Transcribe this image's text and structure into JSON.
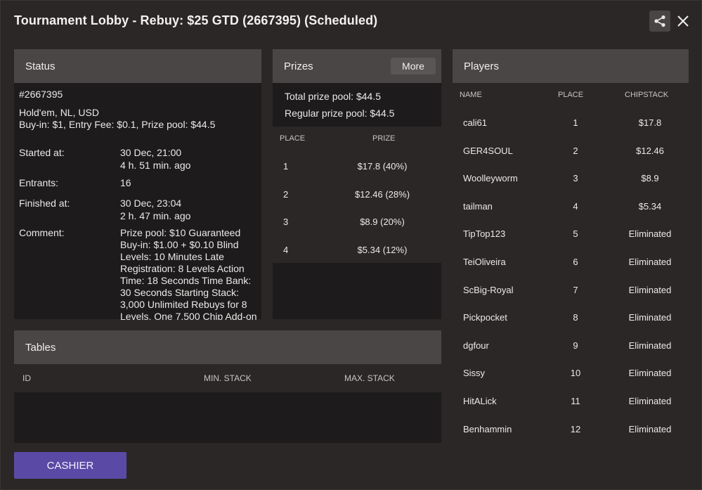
{
  "window": {
    "title": "Tournament Lobby - Rebuy: $25 GTD (2667395) (Scheduled)"
  },
  "icons": {
    "share": "share-icon",
    "close": "close-icon"
  },
  "colors": {
    "accent": "#5a4aa5",
    "panel_header": "#4b4646",
    "panel_body": "#1d1b1b"
  },
  "status": {
    "heading": "Status",
    "id": "#2667395",
    "game": "Hold'em, NL, USD",
    "buyin_line": "Buy-in: $1, Entry Fee: $0.1, Prize pool: $44.5",
    "started_label": "Started at:",
    "started_date": "30 Dec, 21:00",
    "started_ago": "4 h. 51 min. ago",
    "entrants_label": "Entrants:",
    "entrants_value": "16",
    "finished_label": "Finished at:",
    "finished_date": "30 Dec, 23:04",
    "finished_ago": "2 h. 47 min. ago",
    "comment_label": "Comment:",
    "comment_text": "Prize pool: $10 Guaranteed Buy-in: $1.00 + $0.10 Blind Levels: 10 Minutes Late Registration: 8 Levels Action Time: 18 Seconds Time Bank: 30 Seconds Starting Stack: 3,000 Unlimited Rebuys for 8 Levels. One 7,500 Chip Add-on"
  },
  "prizes": {
    "heading": "Prizes",
    "more_label": "More",
    "total_pool": "Total prize pool: $44.5",
    "regular_pool": "Regular prize pool: $44.5",
    "col_place": "PLACE",
    "col_prize": "PRIZE",
    "rows": [
      {
        "place": "1",
        "prize": "$17.8 (40%)"
      },
      {
        "place": "2",
        "prize": "$12.46 (28%)"
      },
      {
        "place": "3",
        "prize": "$8.9 (20%)"
      },
      {
        "place": "4",
        "prize": "$5.34 (12%)"
      }
    ]
  },
  "players": {
    "heading": "Players",
    "col_name": "NAME",
    "col_place": "PLACE",
    "col_chips": "CHIPSTACK",
    "rows": [
      {
        "name": "cali61",
        "place": "1",
        "chips": "$17.8"
      },
      {
        "name": "GER4SOUL",
        "place": "2",
        "chips": "$12.46"
      },
      {
        "name": "Woolleyworm",
        "place": "3",
        "chips": "$8.9"
      },
      {
        "name": "tailman",
        "place": "4",
        "chips": "$5.34"
      },
      {
        "name": "TipTop123",
        "place": "5",
        "chips": "Eliminated"
      },
      {
        "name": "TeiOliveira",
        "place": "6",
        "chips": "Eliminated"
      },
      {
        "name": "ScBig-Royal",
        "place": "7",
        "chips": "Eliminated"
      },
      {
        "name": "Pickpocket",
        "place": "8",
        "chips": "Eliminated"
      },
      {
        "name": "dgfour",
        "place": "9",
        "chips": "Eliminated"
      },
      {
        "name": "Sissy",
        "place": "10",
        "chips": "Eliminated"
      },
      {
        "name": "HitALick",
        "place": "11",
        "chips": "Eliminated"
      },
      {
        "name": "Benhammin",
        "place": "12",
        "chips": "Eliminated"
      }
    ]
  },
  "tables": {
    "heading": "Tables",
    "col_id": "ID",
    "col_min": "MIN. STACK",
    "col_max": "MAX. STACK"
  },
  "footer": {
    "cashier_label": "CASHIER"
  }
}
